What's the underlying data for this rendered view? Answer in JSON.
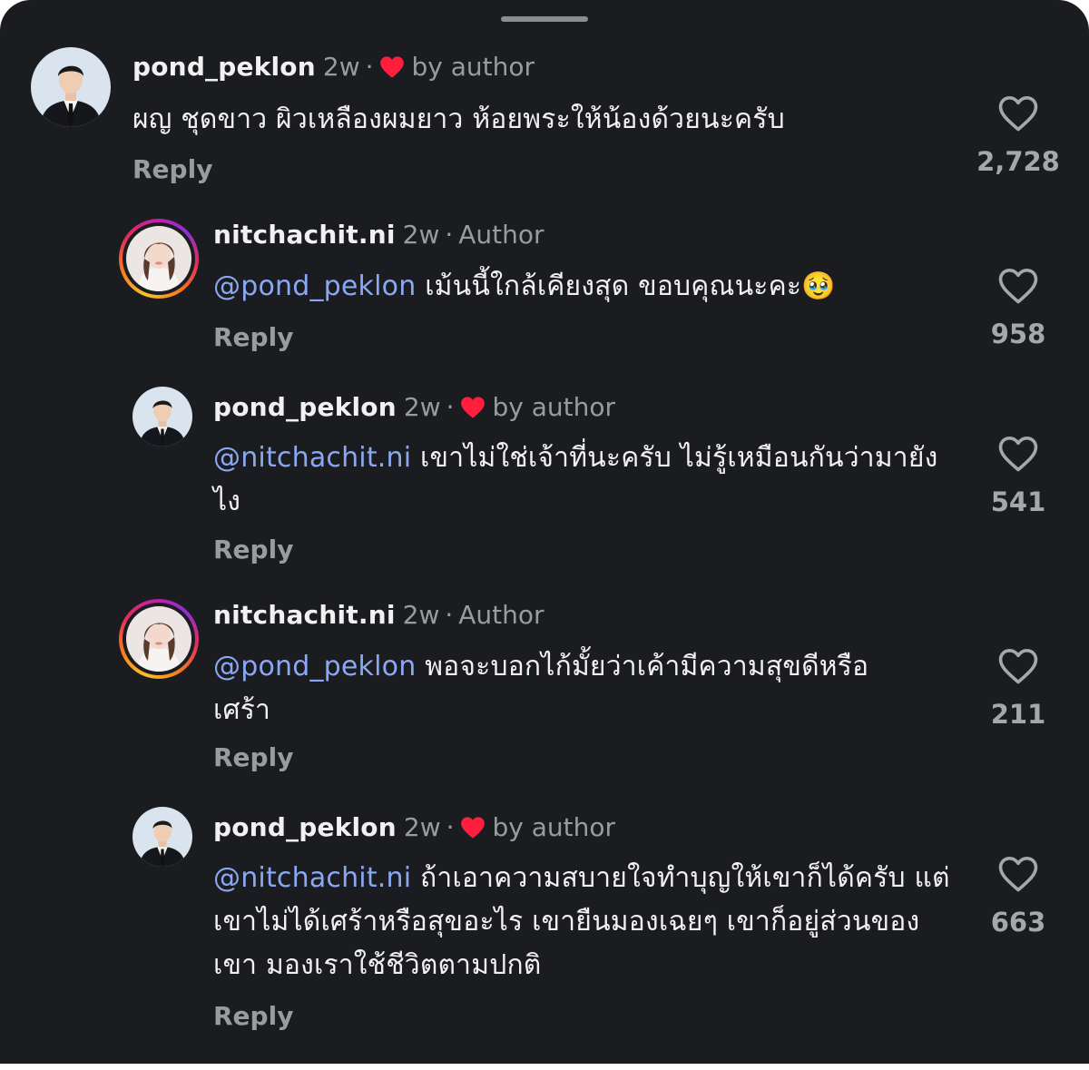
{
  "comments": [
    {
      "username": "pond_peklon",
      "time": "2w",
      "badge": "by author",
      "mention": "",
      "text": "ผญ ชุดขาว ผิวเหลืองผมยาว ห้อยพระให้น้องด้วยนะครับ",
      "reply_label": "Reply",
      "likes": "2,728"
    },
    {
      "username": "nitchachit.ni",
      "time": "2w",
      "badge": "Author",
      "mention": "@pond_peklon",
      "text": "เม้นนี้ใกล้เคียงสุด ขอบคุณนะคะ🥹",
      "reply_label": "Reply",
      "likes": "958"
    },
    {
      "username": "pond_peklon",
      "time": "2w",
      "badge": "by author",
      "mention": "@nitchachit.ni",
      "text": "เขาไม่ใช่เจ้าที่นะครับ ไม่รู้เหมือนกันว่ามายังไง",
      "reply_label": "Reply",
      "likes": "541"
    },
    {
      "username": "nitchachit.ni",
      "time": "2w",
      "badge": "Author",
      "mention": "@pond_peklon",
      "text": "พอจะบอกไก้มั้ยว่าเค้ามีความสุขดีหรือเศร้า",
      "reply_label": "Reply",
      "likes": "211"
    },
    {
      "username": "pond_peklon",
      "time": "2w",
      "badge": "by author",
      "mention": "@nitchachit.ni",
      "text": "ถ้าเอาความสบายใจทำบุญให้เขาก็ได้ครับ แต่เขาไม่ได้เศร้าหรือสุขอะไร เขายืนมองเฉยๆ เขาก็อยู่ส่วนของเขา มองเราใช้ชีวิตตามปกติ",
      "reply_label": "Reply",
      "likes": "663"
    }
  ],
  "separator": "·",
  "icons": {
    "author_like": "red-heart-icon",
    "like_button": "heart-outline-icon",
    "pond_avatar": "man-in-suit-avatar",
    "nitchachit_avatar": "woman-portrait-avatar-with-story-ring"
  },
  "colors": {
    "background": "#1b1c20",
    "mention": "#8aa8f2",
    "author_heart": "#ff1f3d",
    "muted_text": "#9a9ba0"
  }
}
